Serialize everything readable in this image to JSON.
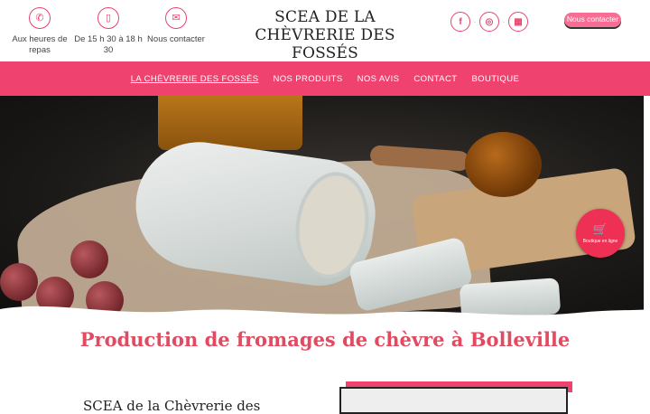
{
  "header": {
    "hours_label": "Aux heures de repas",
    "time_label": "De 15 h 30 à 18 h 30",
    "contact_label": "Nous contacter",
    "brand": "SCEA DE LA CHÈVRERIE DES FOSSÉS",
    "cta_label": "Nous contacter",
    "icons": [
      "phone-icon",
      "mobile-icon",
      "mail-icon",
      "facebook-icon",
      "instagram-icon",
      "website-icon"
    ]
  },
  "nav": {
    "items": [
      "LA CHÈVRERIE DES FOSSÉS",
      "NOS PRODUITS",
      "NOS AVIS",
      "CONTACT",
      "BOUTIQUE"
    ]
  },
  "hero": {
    "badge_label": "Boutique en ligne"
  },
  "main": {
    "headline": "Production de fromages de chèvre à Bolleville",
    "subheading": "SCEA de la Chèvrerie des"
  },
  "colors": {
    "accent": "#f0426e",
    "headline": "#e14a60",
    "badge": "#ee3055"
  }
}
